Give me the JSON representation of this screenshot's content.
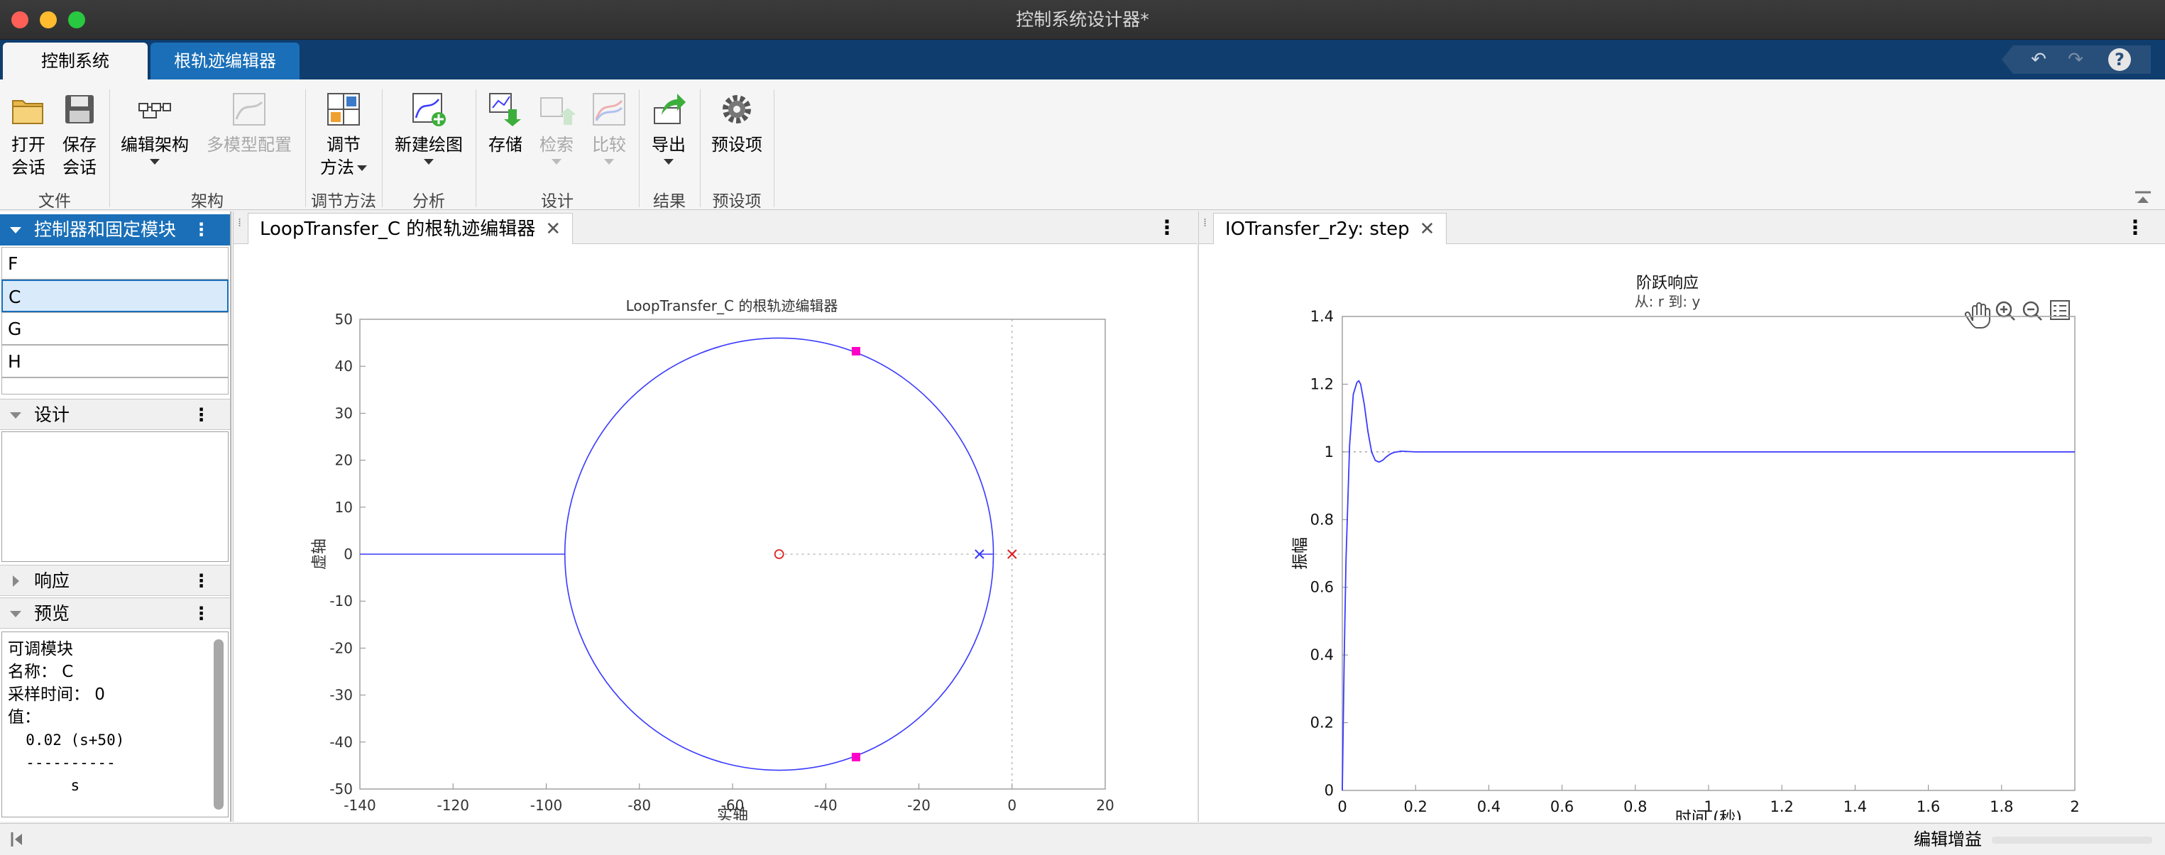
{
  "window": {
    "title": "控制系统设计器*"
  },
  "ribbon_tabs": [
    {
      "label": "控制系统",
      "active": true
    },
    {
      "label": "根轨迹编辑器",
      "active": false
    }
  ],
  "quick_access": {
    "undo": "↶",
    "redo": "↷",
    "help": "?"
  },
  "toolstrip": {
    "open": [
      "打开",
      "会话"
    ],
    "save": [
      "保存",
      "会话"
    ],
    "edit_arch": "编辑架构",
    "multi_model": "多模型配置",
    "tuning": [
      "调节",
      "方法"
    ],
    "new_plot": "新建绘图",
    "store": "存储",
    "retrieve": "检索",
    "compare": "比较",
    "export": "导出",
    "preferences": "预设项",
    "sections": [
      "文件",
      "架构",
      "调节方法",
      "分析",
      "设计",
      "结果",
      "预设项"
    ]
  },
  "left_panel": {
    "blocks_header": "控制器和固定模块",
    "blocks": [
      "F",
      "C",
      "G",
      "H"
    ],
    "selected_block": "C",
    "design_header": "设计",
    "response_header": "响应",
    "preview_header": "预览",
    "preview": {
      "line1": "可调模块",
      "line2": "名称： C",
      "line3": "采样时间： 0",
      "line4": "值：",
      "line5": "  0.02 (s+50)",
      "line6": "  ----------",
      "line7": "       s"
    }
  },
  "root_locus": {
    "tab": "LoopTransfer_C 的根轨迹编辑器",
    "title": "LoopTransfer_C 的根轨迹编辑器",
    "xlabel": "实轴",
    "ylabel": "虚轴",
    "x_ticks": [
      "-140",
      "-120",
      "-100",
      "-80",
      "-60",
      "-40",
      "-20",
      "0",
      "20"
    ],
    "y_ticks": [
      "50",
      "40",
      "30",
      "20",
      "10",
      "0",
      "-10",
      "-20",
      "-30",
      "-40",
      "-50"
    ]
  },
  "step": {
    "tab": "IOTransfer_r2y: step",
    "title": "阶跃响应",
    "subtitle": "从: r  到: y",
    "xlabel": "时间 (秒)",
    "ylabel": "振幅",
    "x_ticks": [
      "0",
      "0.2",
      "0.4",
      "0.6",
      "0.8",
      "1",
      "1.2",
      "1.4",
      "1.6",
      "1.8",
      "2"
    ],
    "y_ticks": [
      "1.4",
      "1.2",
      "1",
      "0.8",
      "0.6",
      "0.4",
      "0.2",
      "0"
    ]
  },
  "chart_data": [
    {
      "type": "scatter",
      "title": "LoopTransfer_C 的根轨迹编辑器",
      "xlabel": "实轴",
      "ylabel": "虚轴",
      "xlim": [
        -140,
        20
      ],
      "ylim": [
        -50,
        50
      ],
      "locus_circle": {
        "center": [
          -50,
          0
        ],
        "radius": 46
      },
      "real_axis_locus": [
        [
          -140,
          -96
        ],
        [
          -4,
          -7
        ]
      ],
      "poles": [
        [
          0,
          0
        ],
        [
          -7,
          0
        ]
      ],
      "zeros": [
        [
          -50,
          0
        ]
      ],
      "closed_loop_poles": [
        [
          -33.5,
          43.2
        ],
        [
          -33.5,
          -43.2
        ]
      ],
      "grid": false,
      "colors": {
        "locus": "#3a3aff",
        "pole_zero": "#e02020",
        "closed_loop": "#ff00c8",
        "open_pole": "#3a3aff"
      }
    },
    {
      "type": "line",
      "title": "阶跃响应",
      "subtitle": "从: r  到: y",
      "xlabel": "时间 (秒)",
      "ylabel": "振幅",
      "xlim": [
        0,
        2
      ],
      "ylim": [
        0,
        1.4
      ],
      "series": [
        {
          "x": [
            0,
            0.005,
            0.01,
            0.02,
            0.03,
            0.04,
            0.045,
            0.05,
            0.06,
            0.07,
            0.08,
            0.09,
            0.1,
            0.11,
            0.12,
            0.13,
            0.14,
            0.16,
            0.18,
            0.2,
            0.3,
            0.5,
            1.0,
            1.5,
            2.0
          ],
          "y": [
            0,
            0.38,
            0.68,
            1.02,
            1.17,
            1.205,
            1.21,
            1.2,
            1.14,
            1.06,
            1.0,
            0.975,
            0.97,
            0.975,
            0.985,
            0.993,
            0.998,
            1.002,
            1.001,
            1.0,
            1.0,
            1.0,
            1.0,
            1.0,
            1.0
          ]
        }
      ],
      "reference_y": 1,
      "grid": false,
      "colors": {
        "response": "#3a3aff"
      }
    }
  ],
  "status": {
    "text": "编辑增益"
  }
}
